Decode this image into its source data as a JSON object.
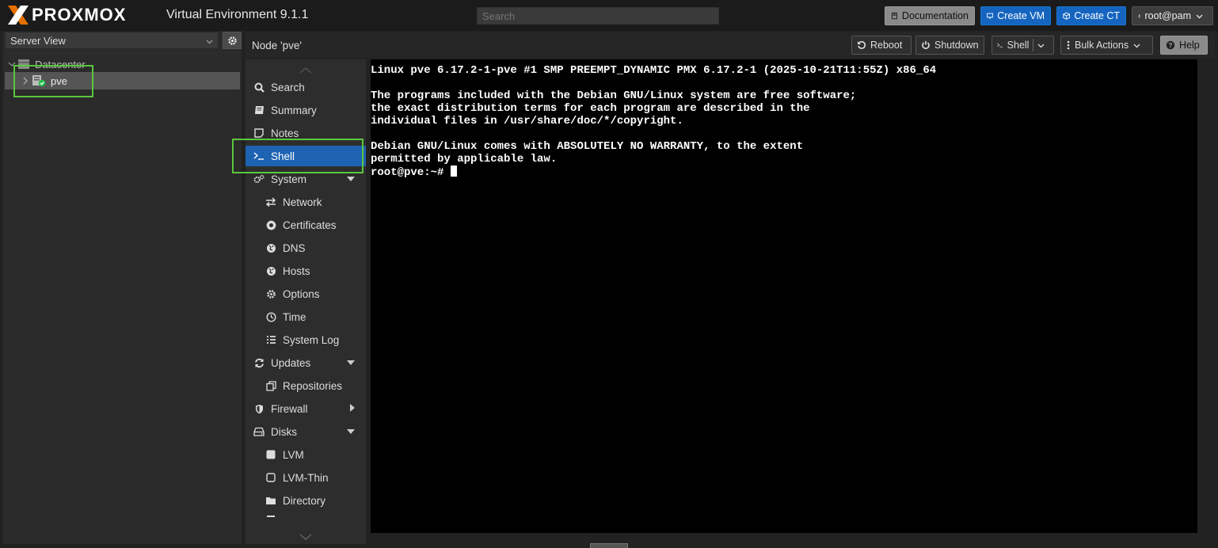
{
  "topbar": {
    "logo_text": "PROXMOX",
    "version": "Virtual Environment 9.1.1",
    "search_placeholder": "Search",
    "documentation": "Documentation",
    "create_vm": "Create VM",
    "create_ct": "Create CT",
    "user": "root@pam"
  },
  "left": {
    "view": "Server View",
    "datacenter": "Datacenter",
    "node": "pve"
  },
  "header": {
    "title": "Node 'pve'",
    "reboot": "Reboot",
    "shutdown": "Shutdown",
    "shell": "Shell",
    "bulk": "Bulk Actions",
    "help": "Help"
  },
  "menu": {
    "search": "Search",
    "summary": "Summary",
    "notes": "Notes",
    "shell": "Shell",
    "system": "System",
    "network": "Network",
    "certificates": "Certificates",
    "dns": "DNS",
    "hosts": "Hosts",
    "options": "Options",
    "time": "Time",
    "syslog": "System Log",
    "updates": "Updates",
    "repositories": "Repositories",
    "firewall": "Firewall",
    "disks": "Disks",
    "lvm": "LVM",
    "lvmthin": "LVM-Thin",
    "directory": "Directory"
  },
  "terminal": {
    "line1": "Linux pve 6.17.2-1-pve #1 SMP PREEMPT_DYNAMIC PMX 6.17.2-1 (2025-10-21T11:55Z) x86_64",
    "line2": "",
    "line3": "The programs included with the Debian GNU/Linux system are free software;",
    "line4": "the exact distribution terms for each program are described in the",
    "line5": "individual files in /usr/share/doc/*/copyright.",
    "line6": "",
    "line7": "Debian GNU/Linux comes with ABSOLUTELY NO WARRANTY, to the extent",
    "line8": "permitted by applicable law.",
    "prompt": "root@pve:~# "
  },
  "colors": {
    "accent": "#1565c0",
    "active_menu": "#1d63b1",
    "highlight": "#5cc63f",
    "terminal_bg": "#000000"
  }
}
